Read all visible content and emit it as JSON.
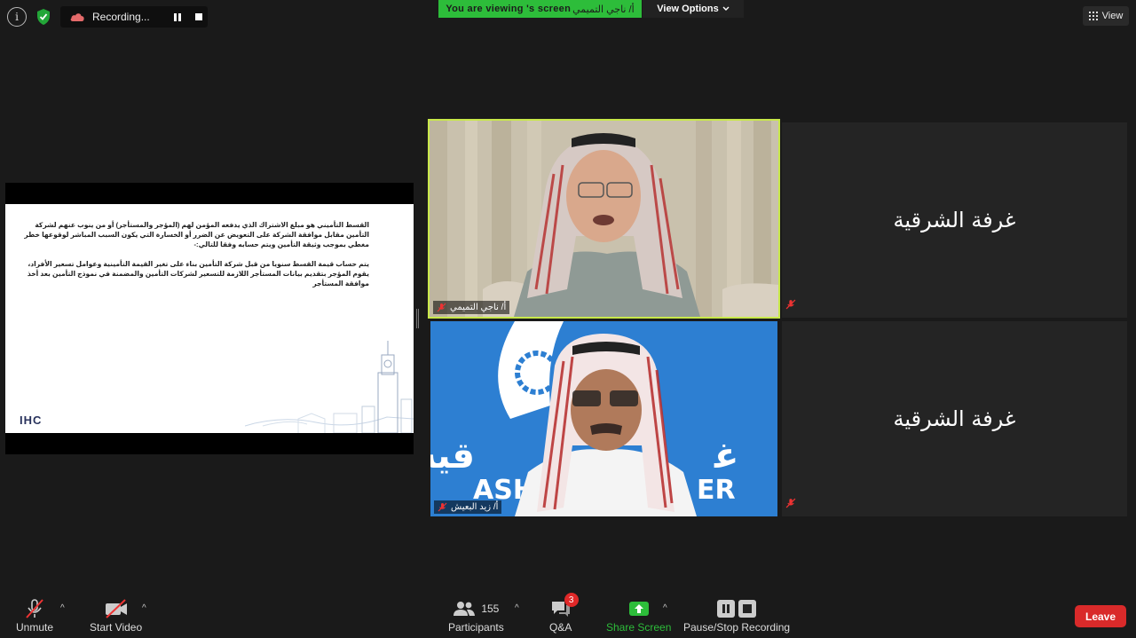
{
  "topbar": {
    "recording_label": "Recording...",
    "viewing_prefix": "You are viewing ",
    "viewing_name": "أ/ ناجي التميمي",
    "viewing_suffix": "'s screen",
    "view_options_label": "View Options",
    "view_label": "View"
  },
  "shared_slide": {
    "paragraph_1": "القسط التأميني هو مبلغ الاشتراك الذي يدفعه المؤمن لهم (المؤجر والمستأجر) أو من ينوب عنهم لشركة التأمين مقابل موافقة الشركة على التعويض عن الضرر أو الخسارة التي يكون السبب المباشر لوقوعها خطر مغطي بموجب وثيقة التأمين ويتم حسابه وفقا للتالي:-",
    "paragraph_2": "يتم حساب قيمة القسط سنويا من قبل شركة التأمين بناء على تغير القيمة التأمينية وعوامل تسعير الأفراد، يقوم المؤجر بتقديم بيانات المستأجر اللازمة للتسعير لشركات التأمين والمضمنة في نموذج التأمين بعد أخذ موافقة المستأجر",
    "logo": "IHC"
  },
  "participants_tiles": [
    {
      "name": "أ/ ناجي التميمي",
      "active_speaker": true
    },
    {
      "name": "أ/ زيد البعيش",
      "active_speaker": false
    },
    {
      "name": "غرفة الشرقية"
    },
    {
      "name": "غرفة الشرقية"
    }
  ],
  "background_text": {
    "line1": "غرفة الشرقية",
    "line2": "ASH  ER"
  },
  "toolbar": {
    "unmute_label": "Unmute",
    "start_video_label": "Start Video",
    "participants_label": "Participants",
    "participants_count": "155",
    "qa_label": "Q&A",
    "qa_badge": "3",
    "share_screen_label": "Share Screen",
    "recording_label": "Pause/Stop Recording",
    "leave_label": "Leave"
  },
  "colors": {
    "share_green": "#2dbd3a",
    "leave_red": "#d92a2a",
    "active_speaker_border": "#c8e84a"
  }
}
